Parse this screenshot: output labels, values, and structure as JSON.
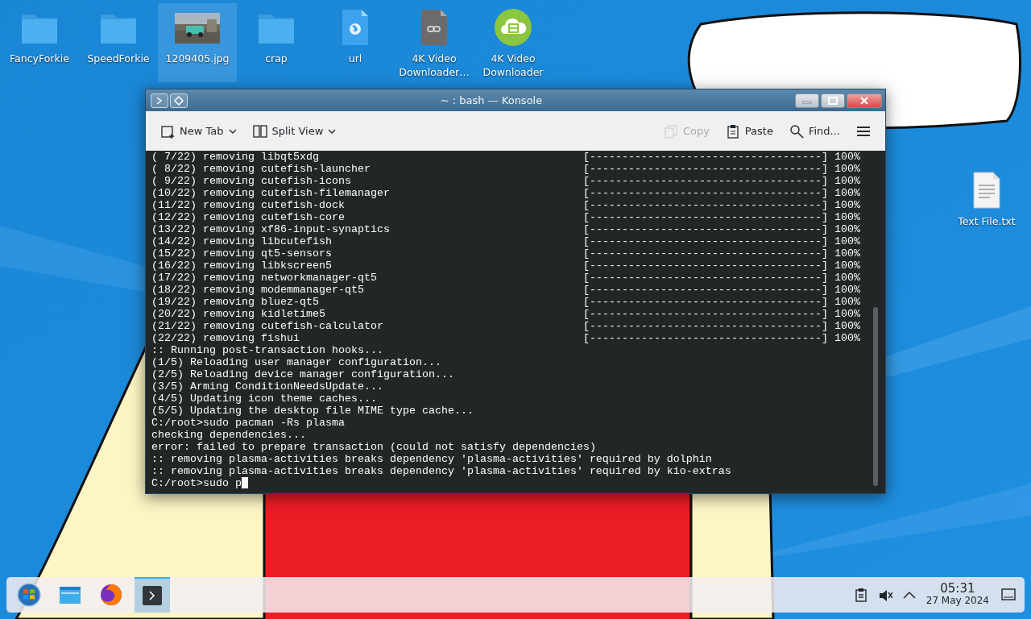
{
  "desktop_icons": [
    {
      "label": "FancyForkie",
      "kind": "folder",
      "selected": false
    },
    {
      "label": "SpeedForkie",
      "kind": "folder",
      "selected": false
    },
    {
      "label": "1209405.jpg",
      "selected": true
    },
    {
      "label": "crap",
      "kind": "folder",
      "selected": false
    },
    {
      "label": "url",
      "kind": "web-doc",
      "selected": false
    },
    {
      "label": "4K Video Downloader…",
      "kind": "link-doc",
      "selected": false
    },
    {
      "label": "4K Video Downloader",
      "kind": "app",
      "selected": false
    }
  ],
  "desktop_icons_right": [
    {
      "label": "Text File.txt",
      "kind": "text-doc",
      "selected": false
    }
  ],
  "window": {
    "title": "~ : bash — Konsole",
    "toolbar": [
      {
        "kind": "new-tab",
        "label": "New Tab",
        "dropdown": true,
        "disabled": false
      },
      {
        "kind": "split-view",
        "label": "Split View",
        "dropdown": true,
        "disabled": false
      },
      {
        "kind": "copy",
        "label": "Copy",
        "dropdown": false,
        "disabled": true
      },
      {
        "kind": "paste",
        "label": "Paste",
        "dropdown": false,
        "disabled": false
      },
      {
        "kind": "find",
        "label": "Find...",
        "dropdown": false,
        "disabled": false
      },
      {
        "kind": "menu",
        "dropdown": false,
        "disabled": false
      }
    ],
    "terminal_lines": [
      {
        "kind": "progress",
        "text": "( 7/22) removing libqt5xdg",
        "bar": "[------------------------------------]",
        "percent": "100%"
      },
      {
        "kind": "progress",
        "text": "( 8/22) removing cutefish-launcher",
        "bar": "[------------------------------------]",
        "percent": "100%"
      },
      {
        "kind": "progress",
        "text": "( 9/22) removing cutefish-icons",
        "bar": "[------------------------------------]",
        "percent": "100%"
      },
      {
        "kind": "progress",
        "text": "(10/22) removing cutefish-filemanager",
        "bar": "[------------------------------------]",
        "percent": "100%"
      },
      {
        "kind": "progress",
        "text": "(11/22) removing cutefish-dock",
        "bar": "[------------------------------------]",
        "percent": "100%"
      },
      {
        "kind": "progress",
        "text": "(12/22) removing cutefish-core",
        "bar": "[------------------------------------]",
        "percent": "100%"
      },
      {
        "kind": "progress",
        "text": "(13/22) removing xf86-input-synaptics",
        "bar": "[------------------------------------]",
        "percent": "100%"
      },
      {
        "kind": "progress",
        "text": "(14/22) removing libcutefish",
        "bar": "[------------------------------------]",
        "percent": "100%"
      },
      {
        "kind": "progress",
        "text": "(15/22) removing qt5-sensors",
        "bar": "[------------------------------------]",
        "percent": "100%"
      },
      {
        "kind": "progress",
        "text": "(16/22) removing libkscreen5",
        "bar": "[------------------------------------]",
        "percent": "100%"
      },
      {
        "kind": "progress",
        "text": "(17/22) removing networkmanager-qt5",
        "bar": "[------------------------------------]",
        "percent": "100%"
      },
      {
        "kind": "progress",
        "text": "(18/22) removing modemmanager-qt5",
        "bar": "[------------------------------------]",
        "percent": "100%"
      },
      {
        "kind": "progress",
        "text": "(19/22) removing bluez-qt5",
        "bar": "[------------------------------------]",
        "percent": "100%"
      },
      {
        "kind": "progress",
        "text": "(20/22) removing kidletime5",
        "bar": "[------------------------------------]",
        "percent": "100%"
      },
      {
        "kind": "progress",
        "text": "(21/22) removing cutefish-calculator",
        "bar": "[------------------------------------]",
        "percent": "100%"
      },
      {
        "kind": "progress",
        "text": "(22/22) removing fishui",
        "bar": "[------------------------------------]",
        "percent": "100%"
      },
      {
        "kind": "text",
        "text": ":: Running post-transaction hooks..."
      },
      {
        "kind": "text",
        "text": "(1/5) Reloading user manager configuration..."
      },
      {
        "kind": "text",
        "text": "(2/5) Reloading device manager configuration..."
      },
      {
        "kind": "text",
        "text": "(3/5) Arming ConditionNeedsUpdate..."
      },
      {
        "kind": "text",
        "text": "(4/5) Updating icon theme caches..."
      },
      {
        "kind": "text",
        "text": "(5/5) Updating the desktop file MIME type cache..."
      },
      {
        "kind": "text",
        "text": "C:/root>sudo pacman -Rs plasma"
      },
      {
        "kind": "text",
        "text": "checking dependencies..."
      },
      {
        "kind": "text",
        "text": "error: failed to prepare transaction (could not satisfy dependencies)"
      },
      {
        "kind": "text",
        "text": ":: removing plasma-activities breaks dependency 'plasma-activities' required by dolphin"
      },
      {
        "kind": "text",
        "text": ":: removing plasma-activities breaks dependency 'plasma-activities' required by kio-extras"
      },
      {
        "kind": "prompt",
        "text": "C:/root>sudo p",
        "cursor": true
      }
    ]
  },
  "taskbar": {
    "tasks": [
      {
        "kind": "start",
        "selected": false
      },
      {
        "kind": "files",
        "selected": false
      },
      {
        "kind": "browser",
        "selected": false
      },
      {
        "kind": "terminal",
        "selected": true
      }
    ],
    "clock": {
      "time": "05:31",
      "date": "27 May 2024"
    }
  }
}
